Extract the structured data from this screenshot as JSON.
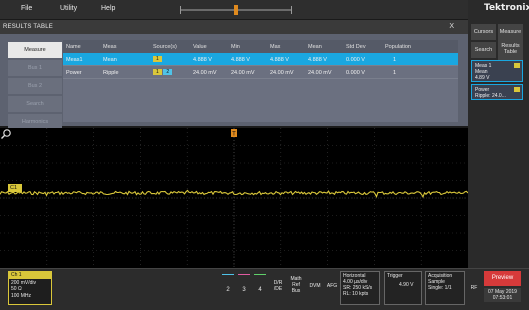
{
  "menu": {
    "file": "File",
    "utility": "Utility",
    "help": "Help"
  },
  "results": {
    "title": "RESULTS TABLE",
    "close": "X",
    "tabs": [
      "Measure",
      "Bus 1",
      "Bus 2",
      "Search",
      "Harmonics"
    ],
    "columns": [
      "Name",
      "Meas",
      "Source(s)",
      "Value",
      "Min",
      "Max",
      "Mean",
      "Std Dev",
      "Population"
    ],
    "rows": [
      {
        "name": "Meas1",
        "meas": "Mean",
        "sources": [
          "1"
        ],
        "value": "4.888 V",
        "min": "4.888 V",
        "max": "4.888 V",
        "mean": "4.888 V",
        "std_dev": "0.000 V",
        "population": "1"
      },
      {
        "name": "Power",
        "meas": "Ripple",
        "sources": [
          "1",
          "2"
        ],
        "value": "24.00 mV",
        "min": "24.00 mV",
        "max": "24.00 mV",
        "mean": "24.00 mV",
        "std_dev": "0.000 V",
        "population": "1"
      }
    ]
  },
  "scope": {
    "channel_marker": "C1",
    "trigger_marker": "T"
  },
  "rail": {
    "logo": "Tektronix",
    "cursors": "Cursors",
    "measure": "Measure",
    "search": "Search",
    "results_table_1": "Results",
    "results_table_2": "Table",
    "meas1": {
      "title": "Meas 1",
      "line1": "Mean",
      "line2": "4.89 V"
    },
    "power": {
      "title": "Power",
      "line1": "Ripple: 24.0..."
    }
  },
  "bottom": {
    "ch1": {
      "title": "Ch 1",
      "l1": "200 mV/div",
      "l2": "50 Ω",
      "l3": "100 MHz"
    },
    "channels": [
      "2",
      "3",
      "4"
    ],
    "drf": [
      "D/R",
      "/DE"
    ],
    "mathrefbus": [
      "Math",
      "Ref",
      "Bus"
    ],
    "dvm": "DVM",
    "afg": "AFG",
    "horizontal": {
      "title": "Horizontal",
      "l1": "4.00 µs/div",
      "l2": "SR: 250 kS/s",
      "l3": "RL: 10 kpts"
    },
    "trigger": {
      "title": "Trigger",
      "level": "4.90 V"
    },
    "acquisition": {
      "title": "Acquisition",
      "l1": "Sample",
      "l2": "Single: 1/1"
    },
    "rf": "RF",
    "preview": "Preview",
    "date": "07 May 2019",
    "time": "07:53:01"
  },
  "colors": {
    "ch1": "#d9c73a",
    "ch2": "#4fc3e8",
    "selected_row": "#1aa7e0",
    "preview": "#d63a3a",
    "trigger_marker": "#e08a1e"
  },
  "icons": {
    "zoom": "magnifier-icon",
    "close": "close-icon"
  }
}
